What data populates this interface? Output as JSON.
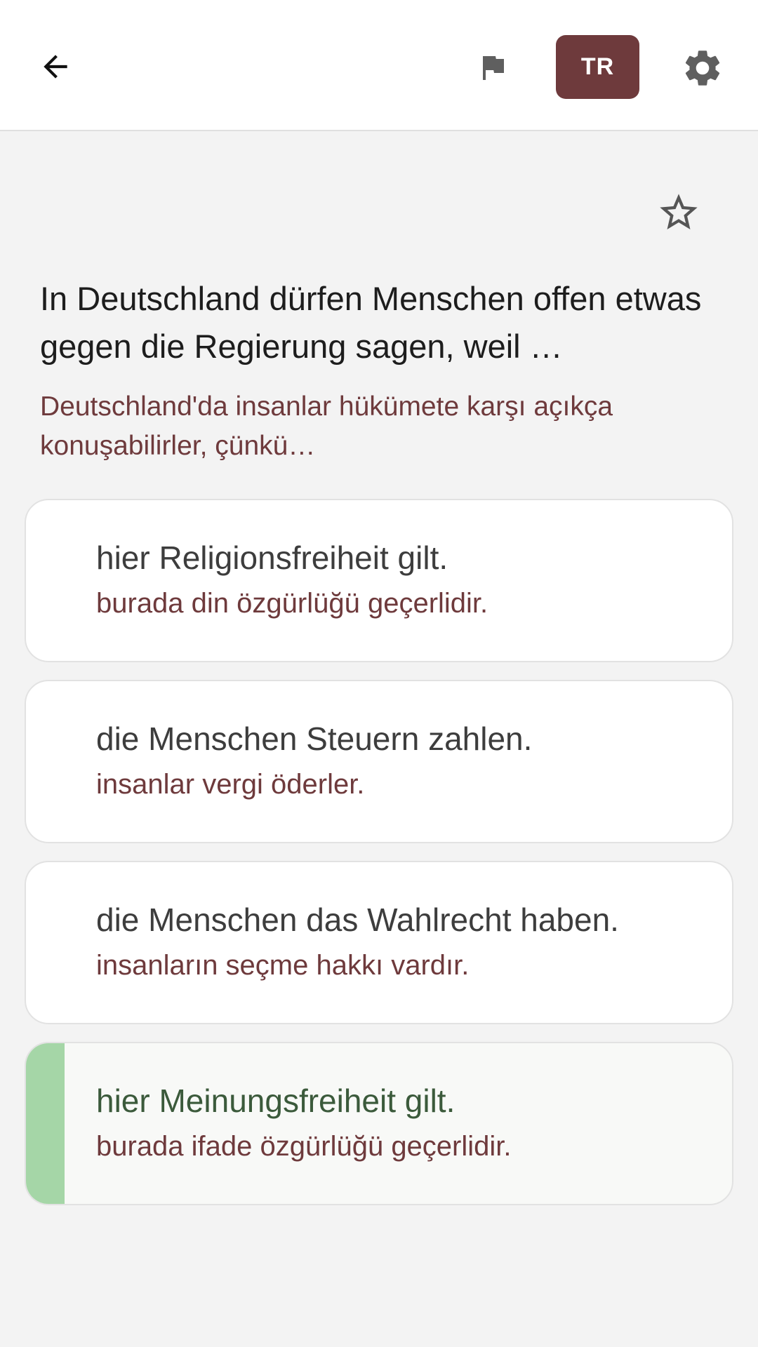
{
  "header": {
    "back_icon": "arrow-back-icon",
    "report_icon": "flag-icon",
    "language_label": "TR",
    "settings_icon": "gear-icon",
    "accent_color": "#6e3a3c"
  },
  "question": {
    "favorite_icon": "star-outline-icon",
    "text_de": "In Deutschland dürfen Menschen offen etwas gegen die Regierung sagen, weil …",
    "text_tr": "Deutschland'da insanlar hükümete karşı açıkça konuşabilirler, çünkü…"
  },
  "answers": [
    {
      "de": "hier Religionsfreiheit gilt.",
      "tr": "burada din özgürlüğü geçerlidir.",
      "correct": false
    },
    {
      "de": "die Menschen Steuern zahlen.",
      "tr": "insanlar vergi öderler.",
      "correct": false
    },
    {
      "de": "die Menschen das Wahlrecht haben.",
      "tr": "insanların seçme hakkı vardır.",
      "correct": false
    },
    {
      "de": "hier Meinungsfreiheit gilt.",
      "tr": "burada ifade özgürlüğü geçerlidir.",
      "correct": true
    }
  ],
  "colors": {
    "correct_indicator": "#a5d6a7",
    "translation_text": "#6e3a3c"
  }
}
